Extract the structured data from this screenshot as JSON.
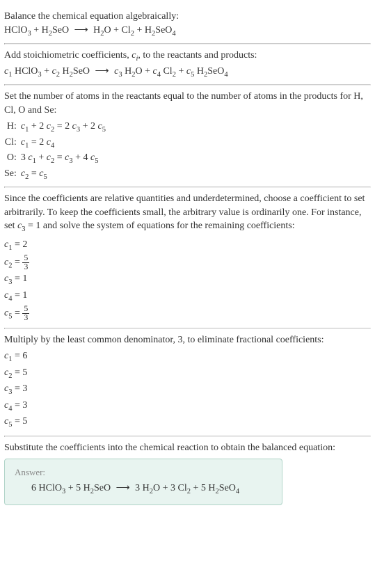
{
  "s1": {
    "line1": "Balance the chemical equation algebraically:",
    "eq_left": "HClO",
    "eq_left_sub3": "3",
    "eq_plus1": " + H",
    "eq_left_sub2a": "2",
    "eq_seo": "SeO",
    "eq_arrow": " ⟶ ",
    "eq_h": " H",
    "eq_sub2b": "2",
    "eq_o": "O + Cl",
    "eq_sub2c": "2",
    "eq_plus2": " + H",
    "eq_sub2d": "2",
    "eq_seo4": "SeO",
    "eq_sub4": "4"
  },
  "s2": {
    "line1_a": "Add stoichiometric coefficients, ",
    "line1_ci": "c",
    "line1_i": "i",
    "line1_b": ", to the reactants and products:",
    "c1": "c",
    "n1": "1",
    "t1": " HClO",
    "sub3": "3",
    "plus1": " + ",
    "c2": "c",
    "n2": "2",
    "t2": " H",
    "sub2a": "2",
    "seo": "SeO",
    "arrow": " ⟶ ",
    "c3": "c",
    "n3": "3",
    "t3": " H",
    "sub2b": "2",
    "o": "O + ",
    "c4": "c",
    "n4": "4",
    "t4": " Cl",
    "sub2c": "2",
    "plus2": " + ",
    "c5": "c",
    "n5": "5",
    "t5": " H",
    "sub2d": "2",
    "seo4": "SeO",
    "sub4": "4"
  },
  "s3": {
    "line1": "Set the number of atoms in the reactants equal to the number of atoms in the products for H, Cl, O and Se:",
    "rows": [
      {
        "label": "H:",
        "c1": "c",
        "s1": "1",
        "t1": " + 2 ",
        "c2": "c",
        "s2": "2",
        "eq": " = 2 ",
        "c3": "c",
        "s3": "3",
        "t2": " + 2 ",
        "c5": "c",
        "s5": "5"
      },
      {
        "label": "Cl:",
        "c1": "c",
        "s1": "1",
        "eq": " = 2 ",
        "c4": "c",
        "s4": "4"
      },
      {
        "label": "O:",
        "t0": "3 ",
        "c1": "c",
        "s1": "1",
        "t1": " + ",
        "c2": "c",
        "s2": "2",
        "eq": " = ",
        "c3": "c",
        "s3": "3",
        "t2": " + 4 ",
        "c5": "c",
        "s5": "5"
      },
      {
        "label": "Se:",
        "c2": "c",
        "s2": "2",
        "eq": " = ",
        "c5": "c",
        "s5": "5"
      }
    ]
  },
  "s4": {
    "line1_a": "Since the coefficients are relative quantities and underdetermined, choose a coefficient to set arbitrarily. To keep the coefficients small, the arbitrary value is ordinarily one. For instance, set ",
    "c3": "c",
    "s3": "3",
    "line1_b": " = 1 and solve the system of equations for the remaining coefficients:",
    "coefs": [
      {
        "c": "c",
        "s": "1",
        "eq": " = 2"
      },
      {
        "c": "c",
        "s": "2",
        "eq": " = ",
        "num": "5",
        "den": "3"
      },
      {
        "c": "c",
        "s": "3",
        "eq": " = 1"
      },
      {
        "c": "c",
        "s": "4",
        "eq": " = 1"
      },
      {
        "c": "c",
        "s": "5",
        "eq": " = ",
        "num": "5",
        "den": "3"
      }
    ]
  },
  "s5": {
    "line1": "Multiply by the least common denominator, 3, to eliminate fractional coefficients:",
    "coefs": [
      {
        "c": "c",
        "s": "1",
        "eq": " = 6"
      },
      {
        "c": "c",
        "s": "2",
        "eq": " = 5"
      },
      {
        "c": "c",
        "s": "3",
        "eq": " = 3"
      },
      {
        "c": "c",
        "s": "4",
        "eq": " = 3"
      },
      {
        "c": "c",
        "s": "5",
        "eq": " = 5"
      }
    ]
  },
  "s6": {
    "line1": "Substitute the coefficients into the chemical reaction to obtain the balanced equation:"
  },
  "answer": {
    "label": "Answer:",
    "v1": "6 HClO",
    "sub3": "3",
    "plus1": " + 5 H",
    "sub2a": "2",
    "seo": "SeO",
    "arrow": " ⟶ ",
    "v2": " 3 H",
    "sub2b": "2",
    "o": "O + 3 Cl",
    "sub2c": "2",
    "plus2": " + 5 H",
    "sub2d": "2",
    "seo4": "SeO",
    "sub4": "4"
  }
}
